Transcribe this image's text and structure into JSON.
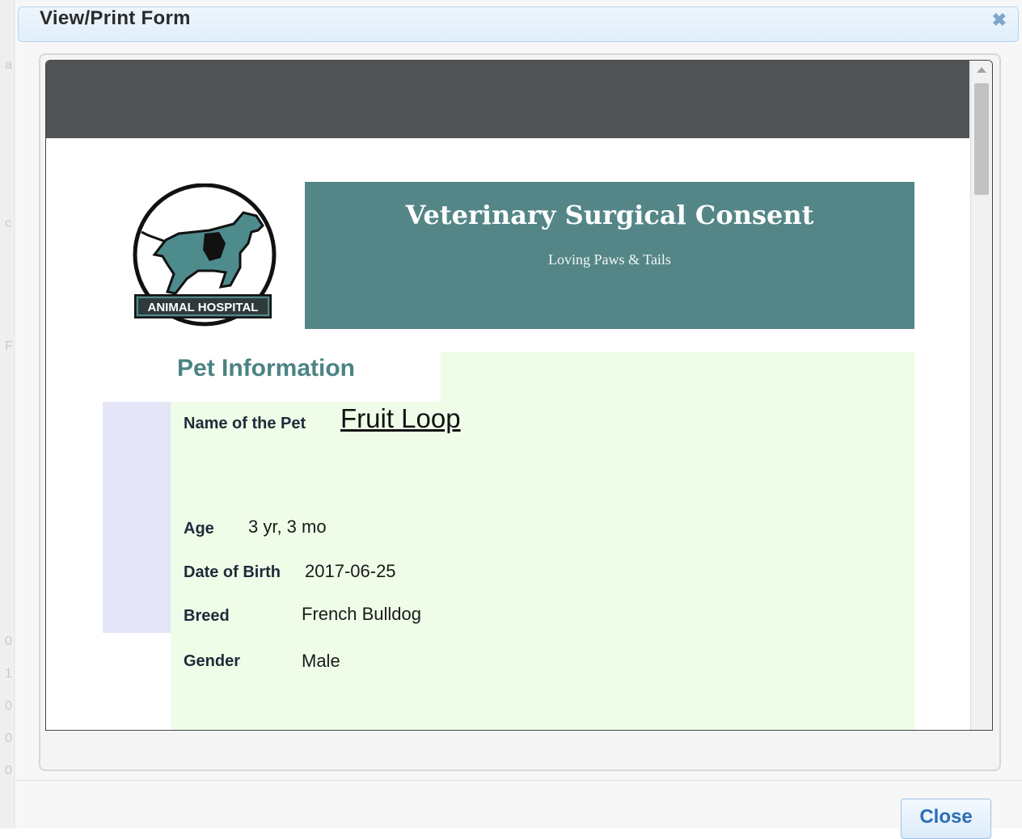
{
  "dialog": {
    "title": "View/Print Form",
    "close_button_label": "Close"
  },
  "form": {
    "banner_title": "Veterinary Surgical Consent",
    "banner_subtitle": "Loving Paws & Tails",
    "logo_text": "ANIMAL HOSPITAL",
    "section_title": "Pet Information",
    "fields": {
      "name": {
        "label": "Name of the Pet",
        "value": "Fruit Loop"
      },
      "age": {
        "label": "Age",
        "value": "3 yr, 3 mo"
      },
      "dob": {
        "label": "Date of Birth",
        "value": "2017-06-25"
      },
      "breed": {
        "label": "Breed",
        "value": "French Bulldog"
      },
      "gender": {
        "label": "Gender",
        "value": "Male"
      }
    }
  },
  "colors": {
    "banner": "#558687",
    "section_title": "#4b8384",
    "form_panel": "#effde8",
    "toolbar": "#505457",
    "accent_button_text": "#2a6db5"
  },
  "icons": {
    "dialog_close": "close-x-icon",
    "scroll_up": "scroll-up-arrow-icon"
  }
}
